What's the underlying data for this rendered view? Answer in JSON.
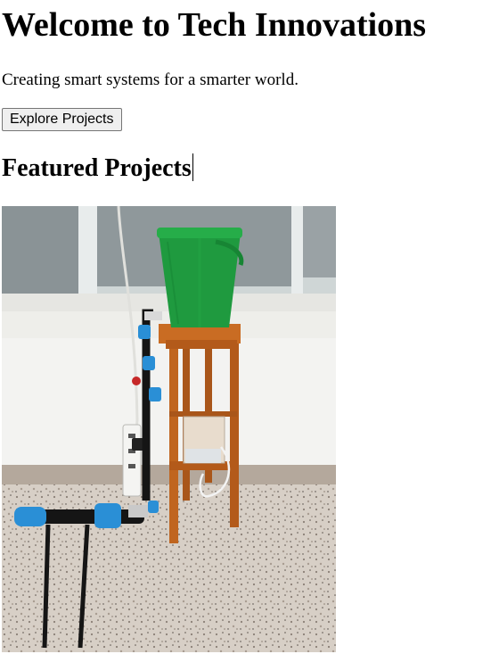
{
  "header": {
    "title": "Welcome to Tech Innovations",
    "tagline": "Creating smart systems for a smarter world."
  },
  "actions": {
    "explore_label": "Explore Projects"
  },
  "featured": {
    "heading": "Featured Projects"
  },
  "colors": {
    "bucket": "#1f9a3f",
    "stand": "#c0651f",
    "pipe": "#151515",
    "connector": "#2a8fd6",
    "wall": "#f3f3f1",
    "floor": "#d9cfc4"
  }
}
